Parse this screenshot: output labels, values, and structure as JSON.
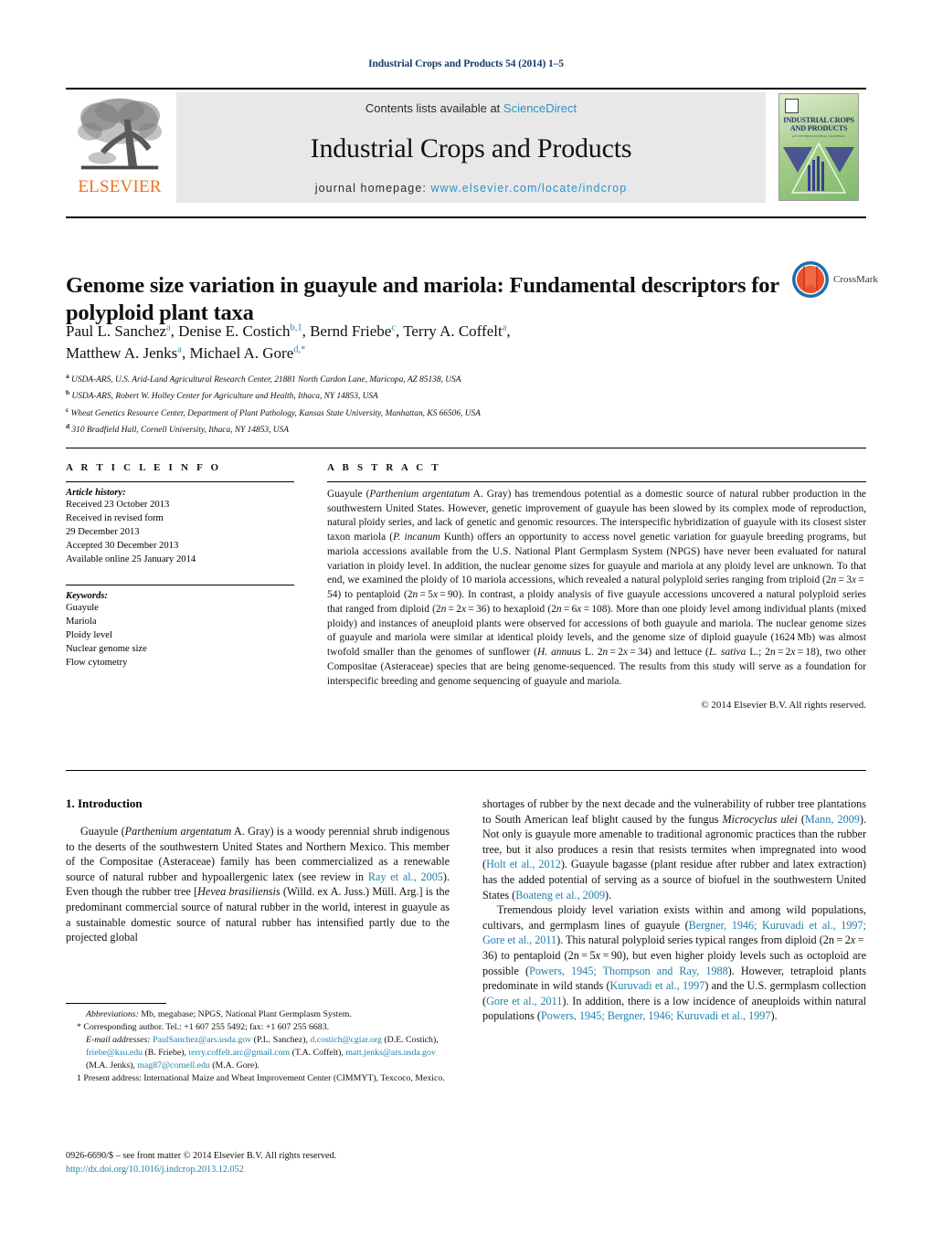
{
  "running_head": "Industrial Crops and Products 54 (2014) 1–5",
  "masthead": {
    "publisher_name": "ELSEVIER",
    "contents_prefix": "Contents lists available at ",
    "contents_link": "ScienceDirect",
    "journal_name": "Industrial Crops and Products",
    "homepage_prefix": "journal homepage: ",
    "homepage_url": "www.elsevier.com/locate/indcrop",
    "cover_title_line1": "INDUSTRIAL CROPS",
    "cover_title_line2": "AND PRODUCTS",
    "cover_subtitle": "AN INTERNATIONAL JOURNAL"
  },
  "article": {
    "title": "Genome size variation in guayule and mariola: Fundamental descriptors for polyploid plant taxa",
    "crossmark_label": "CrossMark",
    "authors_line1_a": "Paul L. Sanchez",
    "authors_line1_a_sup": "a",
    "authors_line1_b": ", Denise E. Costich",
    "authors_line1_b_sup": "b,1",
    "authors_line1_c": ", Bernd Friebe",
    "authors_line1_c_sup": "c",
    "authors_line1_d": ", Terry A. Coffelt",
    "authors_line1_d_sup": "a",
    "authors_line1_tail": ",",
    "authors_line2_a": "Matthew A. Jenks",
    "authors_line2_a_sup": "a",
    "authors_line2_b": ", Michael A. Gore",
    "authors_line2_b_sup": "d,*",
    "affiliations": [
      {
        "mark": "a",
        "text": "USDA-ARS, U.S. Arid-Land Agricultural Research Center, 21881 North Cardon Lane, Maricopa, AZ 85138, USA"
      },
      {
        "mark": "b",
        "text": "USDA-ARS, Robert W. Holley Center for Agriculture and Health, Ithaca, NY 14853, USA"
      },
      {
        "mark": "c",
        "text": "Wheat Genetics Resource Center, Department of Plant Pathology, Kansas State University, Manhattan, KS 66506, USA"
      },
      {
        "mark": "d",
        "text": "310 Bradfield Hall, Cornell University, Ithaca, NY 14853, USA"
      }
    ]
  },
  "article_info": {
    "heading": "A R T I C L E   I N F O",
    "history_label": "Article history:",
    "history_lines": [
      "Received 23 October 2013",
      "Received in revised form",
      "29 December 2013",
      "Accepted 30 December 2013",
      "Available online 25 January 2014"
    ],
    "keywords_label": "Keywords:",
    "keywords": [
      "Guayule",
      "Mariola",
      "Ploidy level",
      "Nuclear genome size",
      "Flow cytometry"
    ]
  },
  "abstract": {
    "heading": "A B S T R A C T",
    "copyright": "© 2014 Elsevier B.V. All rights reserved."
  },
  "body": {
    "intro_heading": "1. Introduction",
    "left_para1_tail": " A. Gray) is a woody perennial shrub indigenous to the deserts of the southwestern United States and Northern Mexico. This member of the Compositae (Asteraceae) family has been commercialized as a renewable source of natural rubber and hypoallergenic latex (see review in ",
    "ref_ray": "Ray et al., 2005",
    "ref_mann": "Mann, 2009",
    "ref_holt": "Holt et al., 2012",
    "ref_boateng": "Boateng et al., 2009",
    "ref_bergner": "Bergner, 1946; Kuruvadi et al., 1997; Gore et al., 2011",
    "ref_powers_thompson": "Powers, 1945; Thompson and Ray, 1988",
    "ref_kuruvadi": "Kuruvadi et al., 1997",
    "ref_gore": "Gore et al., 2011",
    "ref_powers_bergner_kuruvadi": "Powers, 1945; Bergner, 1946; Kuruvadi et al., 1997"
  },
  "footnotes": {
    "abbreviations_label": "Abbreviations:",
    "abbreviations_text": " Mb, megabase; NPGS, National Plant Germplasm System.",
    "corresponding": "* Corresponding author. Tel.: +1 607 255 5492; fax: +1 607 255 6683.",
    "emails_label": "E-mail addresses:",
    "email1": "PaulSanchez@ars.usda.gov",
    "email1_owner": " (P.L. Sanchez), ",
    "email2": "d.costich@cgiar.org",
    "email2_owner": " (D.E. Costich), ",
    "email3": "friebe@ksu.edu",
    "email3_owner": " (B. Friebe), ",
    "email4": "terry.coffelt.arc@gmail.com",
    "email4_owner": " (T.A. Coffelt), ",
    "email5": "matt.jenks@ars.usda.gov",
    "email5_owner": " (M.A. Jenks), ",
    "email6": "mag87@cornell.edu",
    "email6_owner": " (M.A. Gore).",
    "present_address": "1 Present address: International Maize and Wheat Improvement Center (CIMMYT), Texcoco, Mexico.",
    "issn_line": "0926-6690/$ – see front matter © 2014 Elsevier B.V. All rights reserved.",
    "doi_line": "http://dx.doi.org/10.1016/j.indcrop.2013.12.052"
  },
  "colors": {
    "running_head": "#1a3a6b",
    "link": "#2b93c7",
    "reference_link": "#1f7fa8",
    "elsevier_orange": "#f06f1e"
  }
}
